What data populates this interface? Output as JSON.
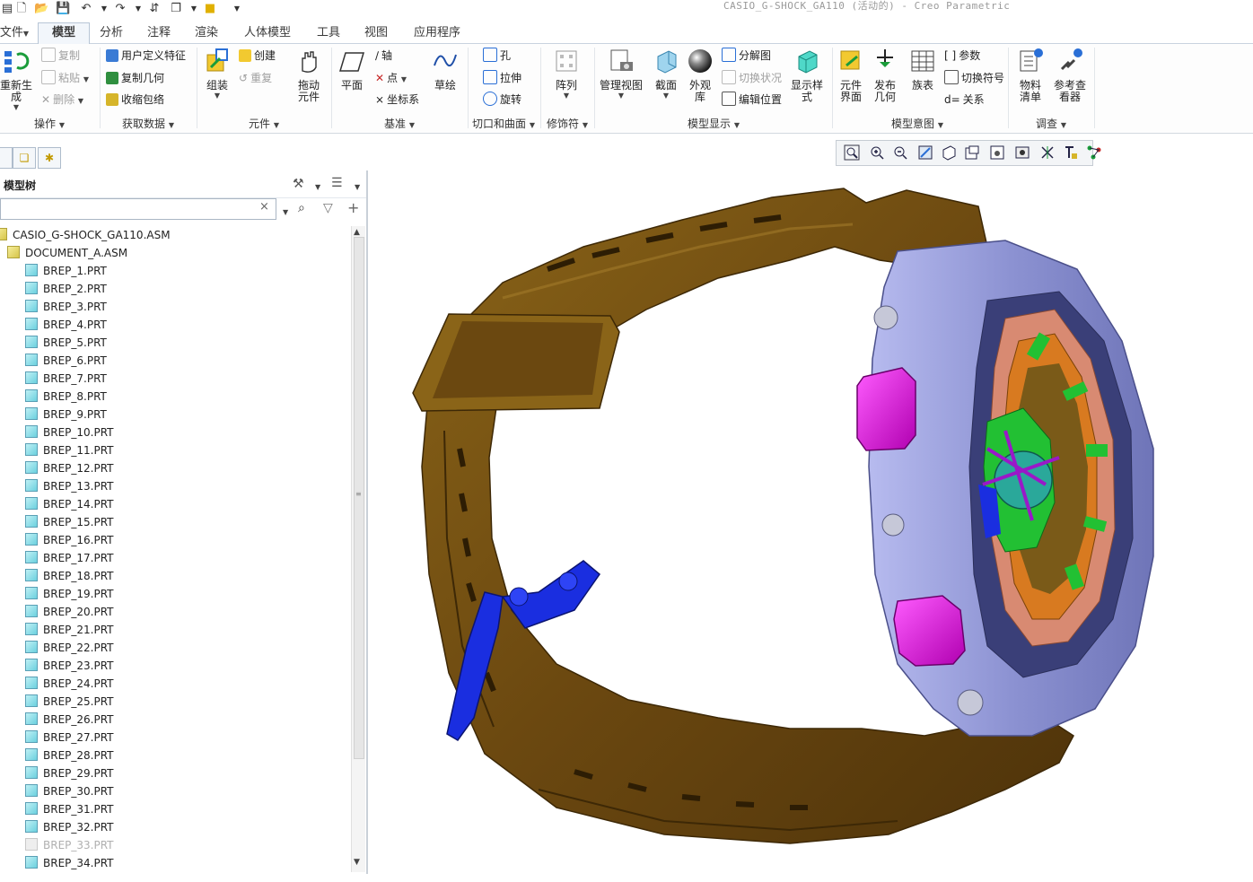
{
  "window": {
    "title": "CASIO_G-SHOCK_GA110 (活动的) - Creo Parametric"
  },
  "tabs": [
    {
      "label": "文件",
      "active": false
    },
    {
      "label": "模型",
      "active": true
    },
    {
      "label": "分析",
      "active": false
    },
    {
      "label": "注释",
      "active": false
    },
    {
      "label": "渲染",
      "active": false
    },
    {
      "label": "人体模型",
      "active": false
    },
    {
      "label": "工具",
      "active": false
    },
    {
      "label": "视图",
      "active": false
    },
    {
      "label": "应用程序",
      "active": false
    }
  ],
  "ribbon": {
    "groups": {
      "operations": "操作",
      "get_data": "获取数据",
      "component": "元件",
      "datum": "基准",
      "cut_surface": "切口和曲面",
      "modifiers": "修饰符",
      "model_display": "模型显示",
      "model_intent": "模型意图",
      "investigate": "调查"
    },
    "buttons": {
      "regenerate": "重新生成",
      "copy": "复制",
      "paste": "粘贴",
      "delete": "删除",
      "udf": "用户定义特征",
      "copy_geom": "复制几何",
      "shrinkwrap": "收缩包络",
      "assemble": "组装",
      "create": "创建",
      "repeat": "重复",
      "drag": "拖动元件",
      "plane": "平面",
      "axis": "轴",
      "point": "点",
      "csys": "坐标系",
      "sketch": "草绘",
      "hole": "孔",
      "extrude": "拉伸",
      "revolve": "旋转",
      "pattern": "阵列",
      "manage_views": "管理视图",
      "section": "截面",
      "appearance": "外观库",
      "display_style": "显示样式",
      "explode": "分解图",
      "toggle_status": "切换状况",
      "edit_position": "编辑位置",
      "component_interface": "元件界面",
      "publish_geom": "发布几何",
      "family_table": "族表",
      "params": "参数",
      "switch_symbol": "切换符号",
      "relations": "关系",
      "bom": "物料清单",
      "ref_viewer": "参考查看器"
    }
  },
  "model_tree": {
    "title": "模型树",
    "root": "CASIO_G-SHOCK_GA110.ASM",
    "sub_assembly": "DOCUMENT_A.ASM",
    "parts": [
      {
        "name": "BREP_1.PRT",
        "suppressed": false
      },
      {
        "name": "BREP_2.PRT",
        "suppressed": false
      },
      {
        "name": "BREP_3.PRT",
        "suppressed": false
      },
      {
        "name": "BREP_4.PRT",
        "suppressed": false
      },
      {
        "name": "BREP_5.PRT",
        "suppressed": false
      },
      {
        "name": "BREP_6.PRT",
        "suppressed": false
      },
      {
        "name": "BREP_7.PRT",
        "suppressed": false
      },
      {
        "name": "BREP_8.PRT",
        "suppressed": false
      },
      {
        "name": "BREP_9.PRT",
        "suppressed": false
      },
      {
        "name": "BREP_10.PRT",
        "suppressed": false
      },
      {
        "name": "BREP_11.PRT",
        "suppressed": false
      },
      {
        "name": "BREP_12.PRT",
        "suppressed": false
      },
      {
        "name": "BREP_13.PRT",
        "suppressed": false
      },
      {
        "name": "BREP_14.PRT",
        "suppressed": false
      },
      {
        "name": "BREP_15.PRT",
        "suppressed": false
      },
      {
        "name": "BREP_16.PRT",
        "suppressed": false
      },
      {
        "name": "BREP_17.PRT",
        "suppressed": false
      },
      {
        "name": "BREP_18.PRT",
        "suppressed": false
      },
      {
        "name": "BREP_19.PRT",
        "suppressed": false
      },
      {
        "name": "BREP_20.PRT",
        "suppressed": false
      },
      {
        "name": "BREP_21.PRT",
        "suppressed": false
      },
      {
        "name": "BREP_22.PRT",
        "suppressed": false
      },
      {
        "name": "BREP_23.PRT",
        "suppressed": false
      },
      {
        "name": "BREP_24.PRT",
        "suppressed": false
      },
      {
        "name": "BREP_25.PRT",
        "suppressed": false
      },
      {
        "name": "BREP_26.PRT",
        "suppressed": false
      },
      {
        "name": "BREP_27.PRT",
        "suppressed": false
      },
      {
        "name": "BREP_28.PRT",
        "suppressed": false
      },
      {
        "name": "BREP_29.PRT",
        "suppressed": false
      },
      {
        "name": "BREP_30.PRT",
        "suppressed": false
      },
      {
        "name": "BREP_31.PRT",
        "suppressed": false
      },
      {
        "name": "BREP_32.PRT",
        "suppressed": false
      },
      {
        "name": "BREP_33.PRT",
        "suppressed": true
      },
      {
        "name": "BREP_34.PRT",
        "suppressed": false
      }
    ]
  },
  "icons": {
    "clear": "×",
    "tree_settings": "tree-settings-icon",
    "tree_show": "show-icon",
    "find": "binoculars-icon",
    "filter": "filter-icon",
    "add_column": "plus-icon"
  },
  "colors": {
    "strap": "#6b4810",
    "bezel": "#8c92d2",
    "button_pad": "#e018e0",
    "buckle": "#1a2ee0",
    "dial_green": "#22c033",
    "dial_ring": "#d88a72"
  }
}
